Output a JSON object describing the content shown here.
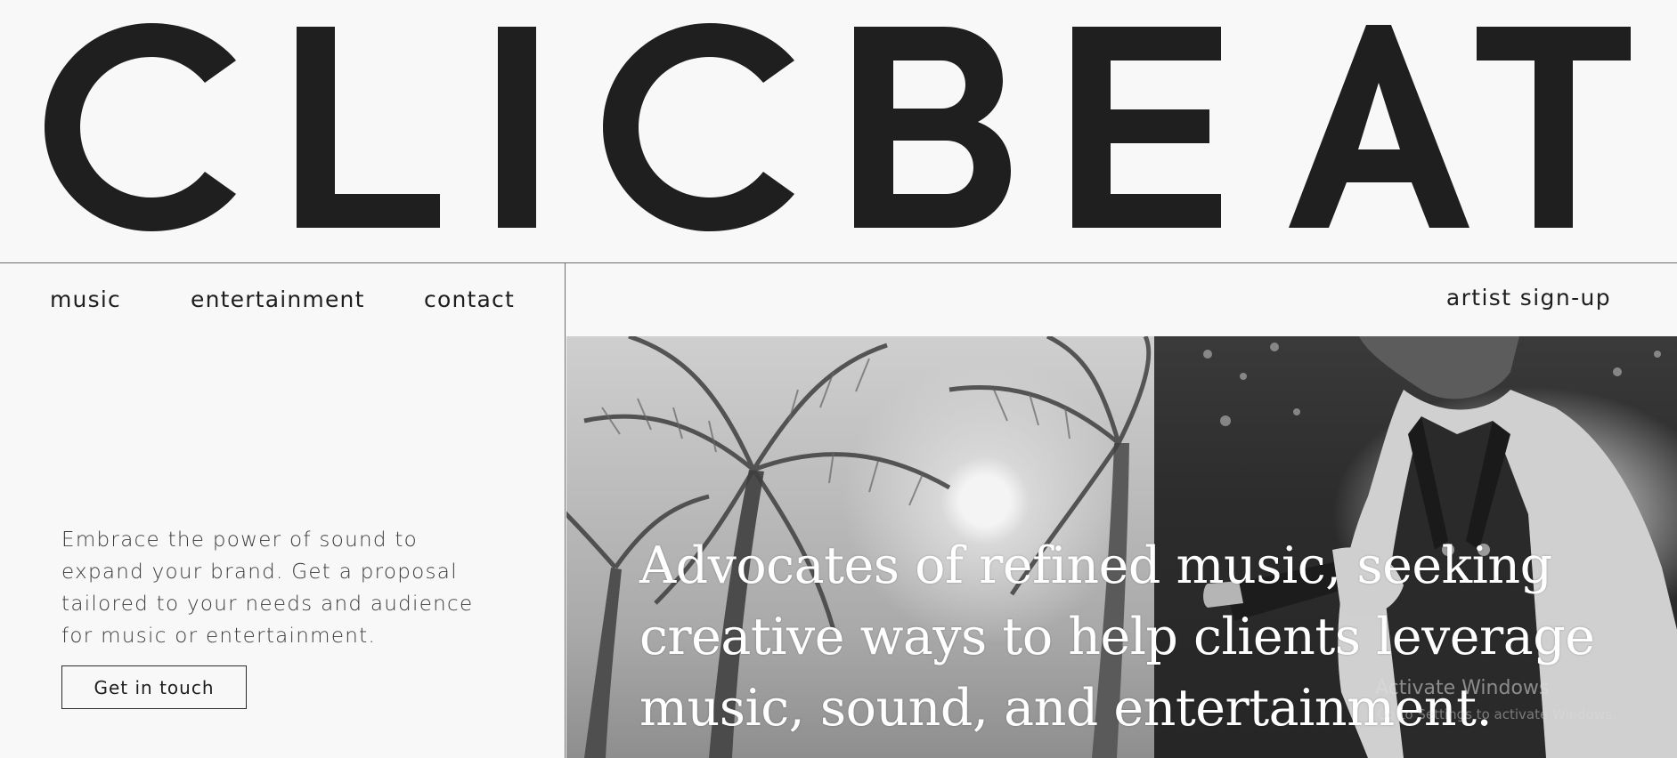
{
  "brand": {
    "name": "CLICBEAT",
    "color": "#1f1f1f"
  },
  "nav": {
    "items": [
      {
        "label": "music"
      },
      {
        "label": "entertainment"
      },
      {
        "label": "contact"
      }
    ],
    "signup_label": "artist sign-up"
  },
  "intro": {
    "text": "Embrace the power of sound to expand your brand. Get a proposal tailored to your needs and audience for music or entertainment.",
    "cta_label": "Get in touch"
  },
  "hero": {
    "headline": "Advocates of refined music, seeking creative ways to help clients leverage music, sound, and entertainment."
  },
  "system": {
    "activation_title": "Activate Windows",
    "activation_sub": "Go to Settings to activate Windows."
  }
}
